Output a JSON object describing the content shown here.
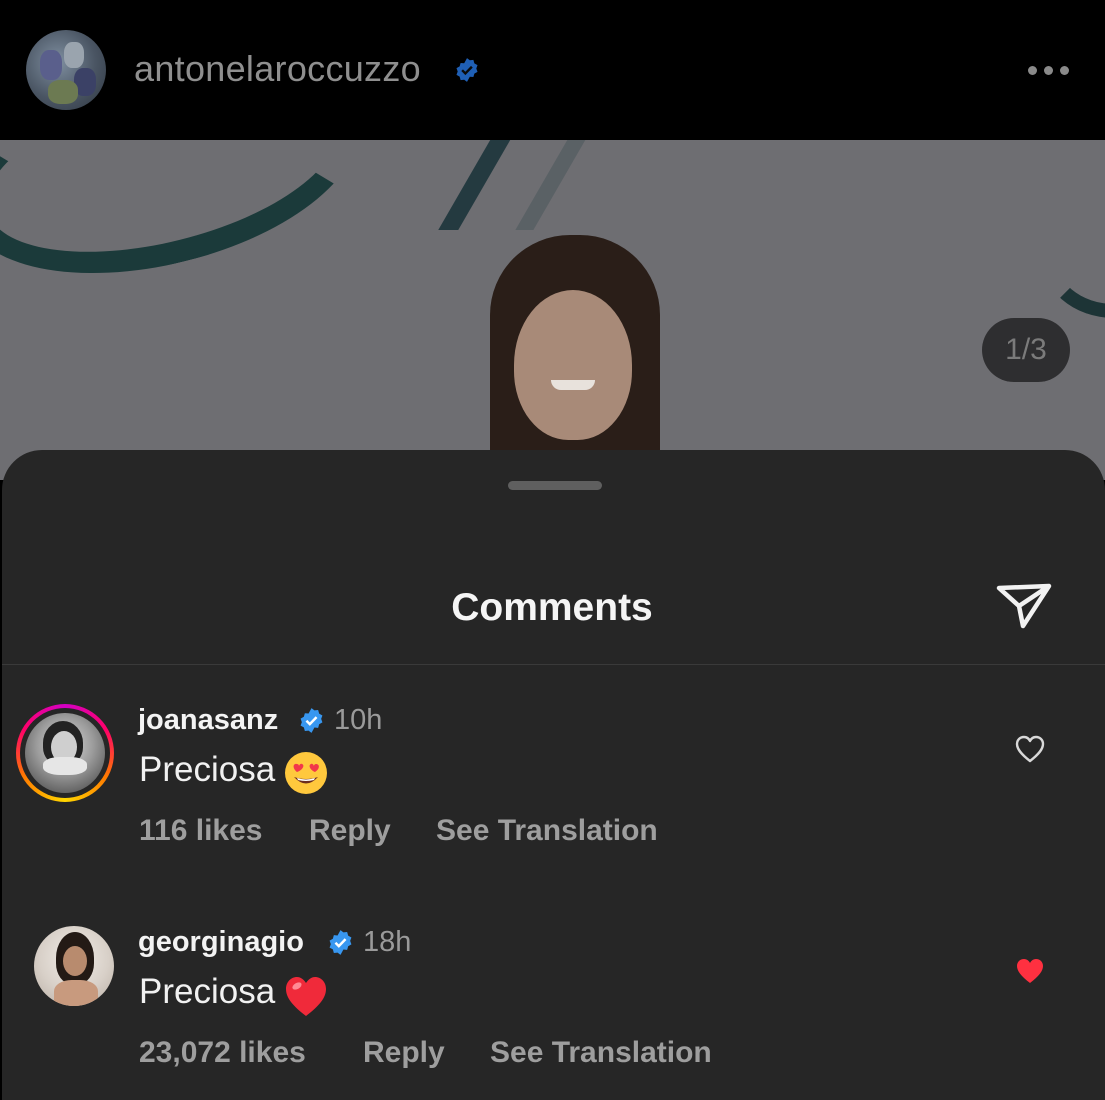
{
  "post": {
    "owner_username": "antonelaroccuzzo",
    "image_counter": "1/3"
  },
  "comments_sheet": {
    "title": "Comments"
  },
  "comments": [
    {
      "username": "joanasanz",
      "time": "10h",
      "text": "Preciosa",
      "emoji": "heart-eyes-emoji",
      "likes": "116 likes",
      "reply_label": "Reply",
      "translate_label": "See Translation",
      "liked": false
    },
    {
      "username": "georginagio",
      "time": "18h",
      "text": "Preciosa",
      "emoji": "red-heart-emoji",
      "likes": "23,072 likes",
      "reply_label": "Reply",
      "translate_label": "See Translation",
      "liked": true
    }
  ],
  "colors": {
    "verified_blue": "#3897f0",
    "like_red": "#ff3040",
    "sheet_bg": "#262626"
  }
}
